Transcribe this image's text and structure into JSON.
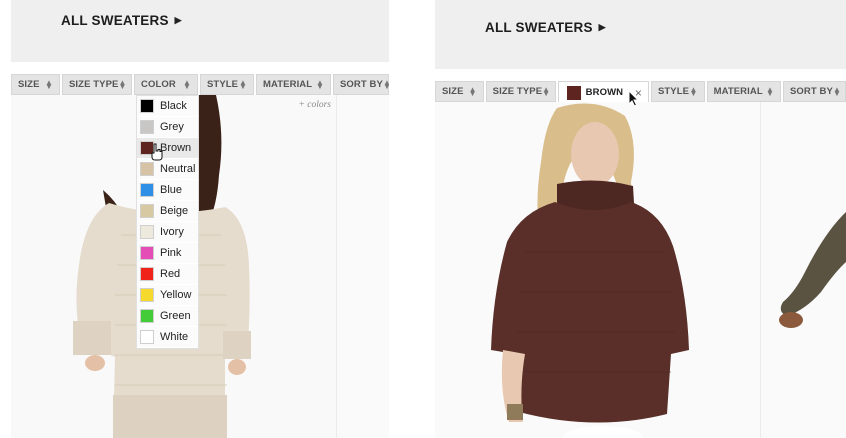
{
  "left": {
    "title": "ALL SWEATERS",
    "filters": [
      "SIZE",
      "SIZE TYPE",
      "COLOR",
      "STYLE",
      "MATERIAL",
      "SORT BY"
    ],
    "more_colors": "+ colors",
    "color_options": [
      {
        "label": "Black",
        "color": "#000000"
      },
      {
        "label": "Grey",
        "color": "#c9c7c5"
      },
      {
        "label": "Brown",
        "color": "#5e2420"
      },
      {
        "label": "Neutral",
        "color": "#d6c3a6"
      },
      {
        "label": "Blue",
        "color": "#2f8fe6"
      },
      {
        "label": "Beige",
        "color": "#d7c9a2"
      },
      {
        "label": "Ivory",
        "color": "#eee9dd"
      },
      {
        "label": "Pink",
        "color": "#e44cb6"
      },
      {
        "label": "Red",
        "color": "#f0231a"
      },
      {
        "label": "Yellow",
        "color": "#f5d92c"
      },
      {
        "label": "Green",
        "color": "#43cc37"
      },
      {
        "label": "White",
        "color": "#ffffff"
      }
    ],
    "hovered_option": "Brown"
  },
  "right": {
    "title": "ALL SWEATERS",
    "filters": [
      "SIZE",
      "SIZE TYPE",
      "BROWN",
      "STYLE",
      "MATERIAL",
      "SORT BY"
    ],
    "active_filter": "BROWN",
    "active_color": "#5e2420"
  }
}
